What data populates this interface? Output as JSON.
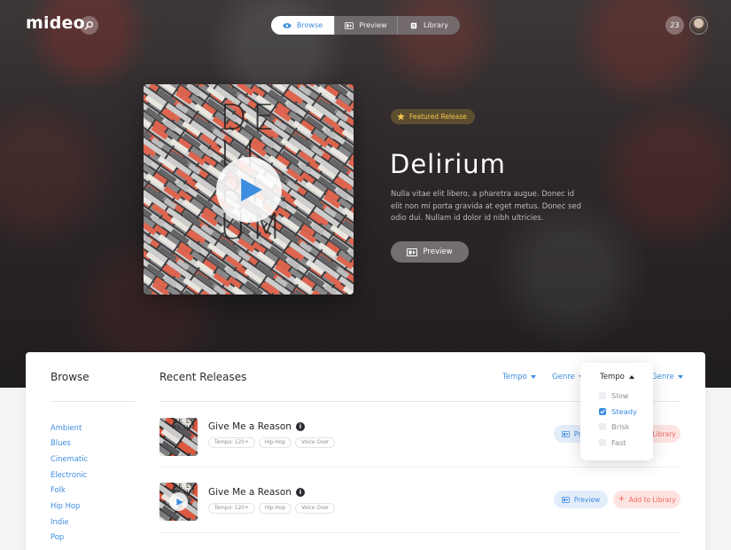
{
  "app": {
    "logo": "mideo",
    "notification_count": "23"
  },
  "nav": {
    "tabs": [
      {
        "label": "Browse",
        "icon": "eye-icon",
        "active": true
      },
      {
        "label": "Preview",
        "icon": "film-icon",
        "active": false
      },
      {
        "label": "Library",
        "icon": "library-icon",
        "active": false
      }
    ]
  },
  "hero": {
    "cover_text": "DE LI RI UM",
    "badge": "Featured Release",
    "title": "Delirium",
    "description": "Nulla vitae elit libero, a pharetra augue. Donec id elit non mi porta gravida at eget metus. Donec sed odio dui. Nullam id dolor id nibh ultricies.",
    "preview_label": "Preview"
  },
  "sidebar": {
    "title": "Browse",
    "genres": [
      "Ambient",
      "Blues",
      "Cinematic",
      "Electronic",
      "Folk",
      "Hip Hop",
      "Indie",
      "Pop"
    ]
  },
  "main": {
    "title": "Recent Releases",
    "filters": [
      "Tempo",
      "Genre",
      "Genre"
    ],
    "tracks": [
      {
        "title": "Give Me a Reason",
        "tags": [
          "Tempo: 120+",
          "Hip-Hop",
          "Voice Over"
        ],
        "preview_label": "Preview",
        "add_label": "Add to Library"
      },
      {
        "title": "Give Me a Reason",
        "tags": [
          "Tempo: 120+",
          "Hip-Hop",
          "Voice Over"
        ],
        "preview_label": "Preview",
        "add_label": "Add to Library"
      }
    ]
  },
  "tempo_dropdown": {
    "label": "Tempo",
    "options": [
      {
        "label": "Slow",
        "checked": false
      },
      {
        "label": "Steady",
        "checked": true
      },
      {
        "label": "Brisk",
        "checked": false
      },
      {
        "label": "Fast",
        "checked": false
      }
    ]
  },
  "colors": {
    "accent": "#3d8de0",
    "add": "#ee6a5b",
    "badge": "#f0c64a"
  }
}
